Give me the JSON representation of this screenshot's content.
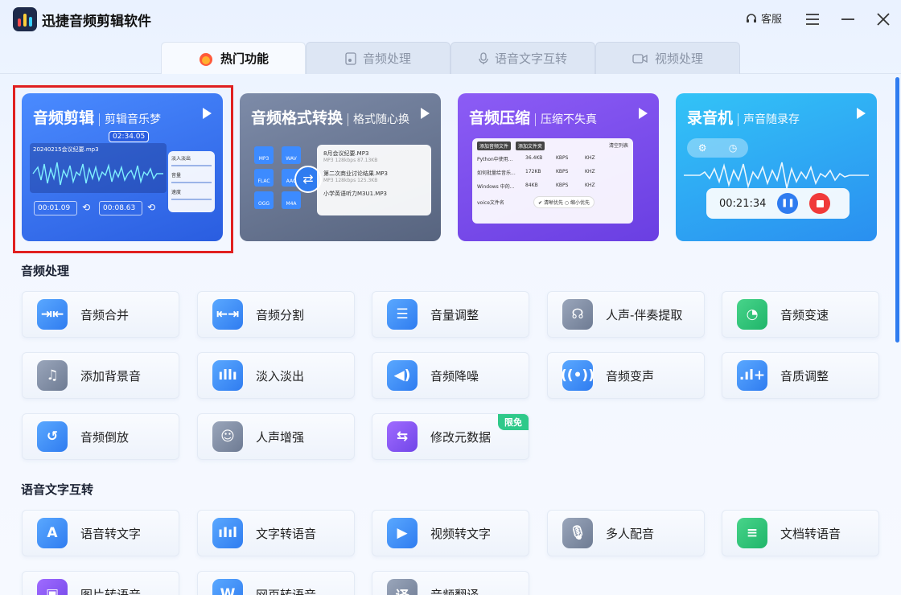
{
  "app": {
    "title": "迅捷音频剪辑软件",
    "support_label": "客服"
  },
  "tabs": [
    {
      "label": "热门功能",
      "icon": "fire-icon",
      "active": true
    },
    {
      "label": "音频处理",
      "icon": "audio-file-icon",
      "active": false
    },
    {
      "label": "语音文字互转",
      "icon": "microphone-icon",
      "active": false
    },
    {
      "label": "视频处理",
      "icon": "video-camera-icon",
      "active": false
    }
  ],
  "feature_cards": [
    {
      "title": "音频剪辑",
      "subtitle": "剪辑音乐梦",
      "mock": {
        "time": "02:34.05",
        "file": "20240215会议纪要.mp3",
        "start": "00:01.09",
        "end": "00:08.63",
        "labels": [
          "淡入淡出",
          "音量",
          "速度"
        ]
      }
    },
    {
      "title": "音频格式转换",
      "subtitle": "格式随心换",
      "mock": {
        "formats": [
          "MP3",
          "WAV",
          "FLAC",
          "AAC",
          "OGG",
          "M4A"
        ],
        "files": [
          {
            "name": "8月会议纪要.MP3",
            "meta": "MP3 128kbps 87.13KB"
          },
          {
            "name": "第二次商业讨论结果.MP3",
            "meta": "MP3 128kbps 125.3KB"
          },
          {
            "name": "小学英语听力M3U1.MP3",
            "meta": ""
          }
        ]
      }
    },
    {
      "title": "音频压缩",
      "subtitle": "压缩不失真",
      "mock": {
        "add_file": "添加音频文件",
        "add_folder": "添加文件夹",
        "clear": "清空列表",
        "rows": [
          {
            "name": "Python中使用...",
            "size": "36.4KB",
            "unit": "KBPS",
            "khz": "KHZ"
          },
          {
            "name": "如何批量给音乐...",
            "size": "172KB",
            "unit": "KBPS",
            "khz": "KHZ"
          },
          {
            "name": "Windows 中的...",
            "size": "84KB",
            "unit": "KBPS",
            "khz": "KHZ"
          },
          {
            "name": "voice文件名",
            "size": "",
            "unit": "",
            "khz": ""
          }
        ],
        "opt1": "清晰优先",
        "opt2": "缩小优先"
      }
    },
    {
      "title": "录音机",
      "subtitle": "声音随录存",
      "mock": {
        "timer": "00:21:34"
      }
    }
  ],
  "sections": {
    "audio": {
      "title": "音频处理",
      "tools": [
        {
          "label": "音频合并",
          "icon": "merge-icon",
          "color": "blue"
        },
        {
          "label": "音频分割",
          "icon": "split-icon",
          "color": "blue"
        },
        {
          "label": "音量调整",
          "icon": "volume-sliders-icon",
          "color": "blue"
        },
        {
          "label": "人声-伴奏提取",
          "icon": "vocal-extract-icon",
          "color": "gray"
        },
        {
          "label": "音频变速",
          "icon": "speed-icon",
          "color": "green"
        },
        {
          "label": "添加背景音",
          "icon": "music-note-icon",
          "color": "gray"
        },
        {
          "label": "淡入淡出",
          "icon": "fade-bars-icon",
          "color": "blue"
        },
        {
          "label": "音频降噪",
          "icon": "speaker-icon",
          "color": "blue"
        },
        {
          "label": "音频变声",
          "icon": "voice-change-icon",
          "color": "blue"
        },
        {
          "label": "音质调整",
          "icon": "quality-bars-icon",
          "color": "blue"
        },
        {
          "label": "音频倒放",
          "icon": "reverse-icon",
          "color": "blue"
        },
        {
          "label": "人声增强",
          "icon": "voice-boost-icon",
          "color": "gray"
        },
        {
          "label": "修改元数据",
          "icon": "metadata-icon",
          "color": "purple",
          "badge": "限免"
        }
      ]
    },
    "speech": {
      "title": "语音文字互转",
      "tools": [
        {
          "label": "语音转文字",
          "icon": "letter-a-icon",
          "color": "blue"
        },
        {
          "label": "文字转语音",
          "icon": "waveform-icon",
          "color": "blue"
        },
        {
          "label": "视频转文字",
          "icon": "play-circle-icon",
          "color": "blue"
        },
        {
          "label": "多人配音",
          "icon": "microphone-icon",
          "color": "gray"
        },
        {
          "label": "文档转语音",
          "icon": "document-icon",
          "color": "green"
        },
        {
          "label": "图片转语音",
          "icon": "image-icon",
          "color": "purple"
        },
        {
          "label": "网页转语音",
          "icon": "web-icon",
          "color": "blue"
        },
        {
          "label": "音频翻译",
          "icon": "translate-icon",
          "color": "gray"
        }
      ]
    }
  },
  "colors": {
    "accent": "#2f7cf0",
    "badge": "#2fc98a",
    "highlight_border": "#e02020"
  }
}
